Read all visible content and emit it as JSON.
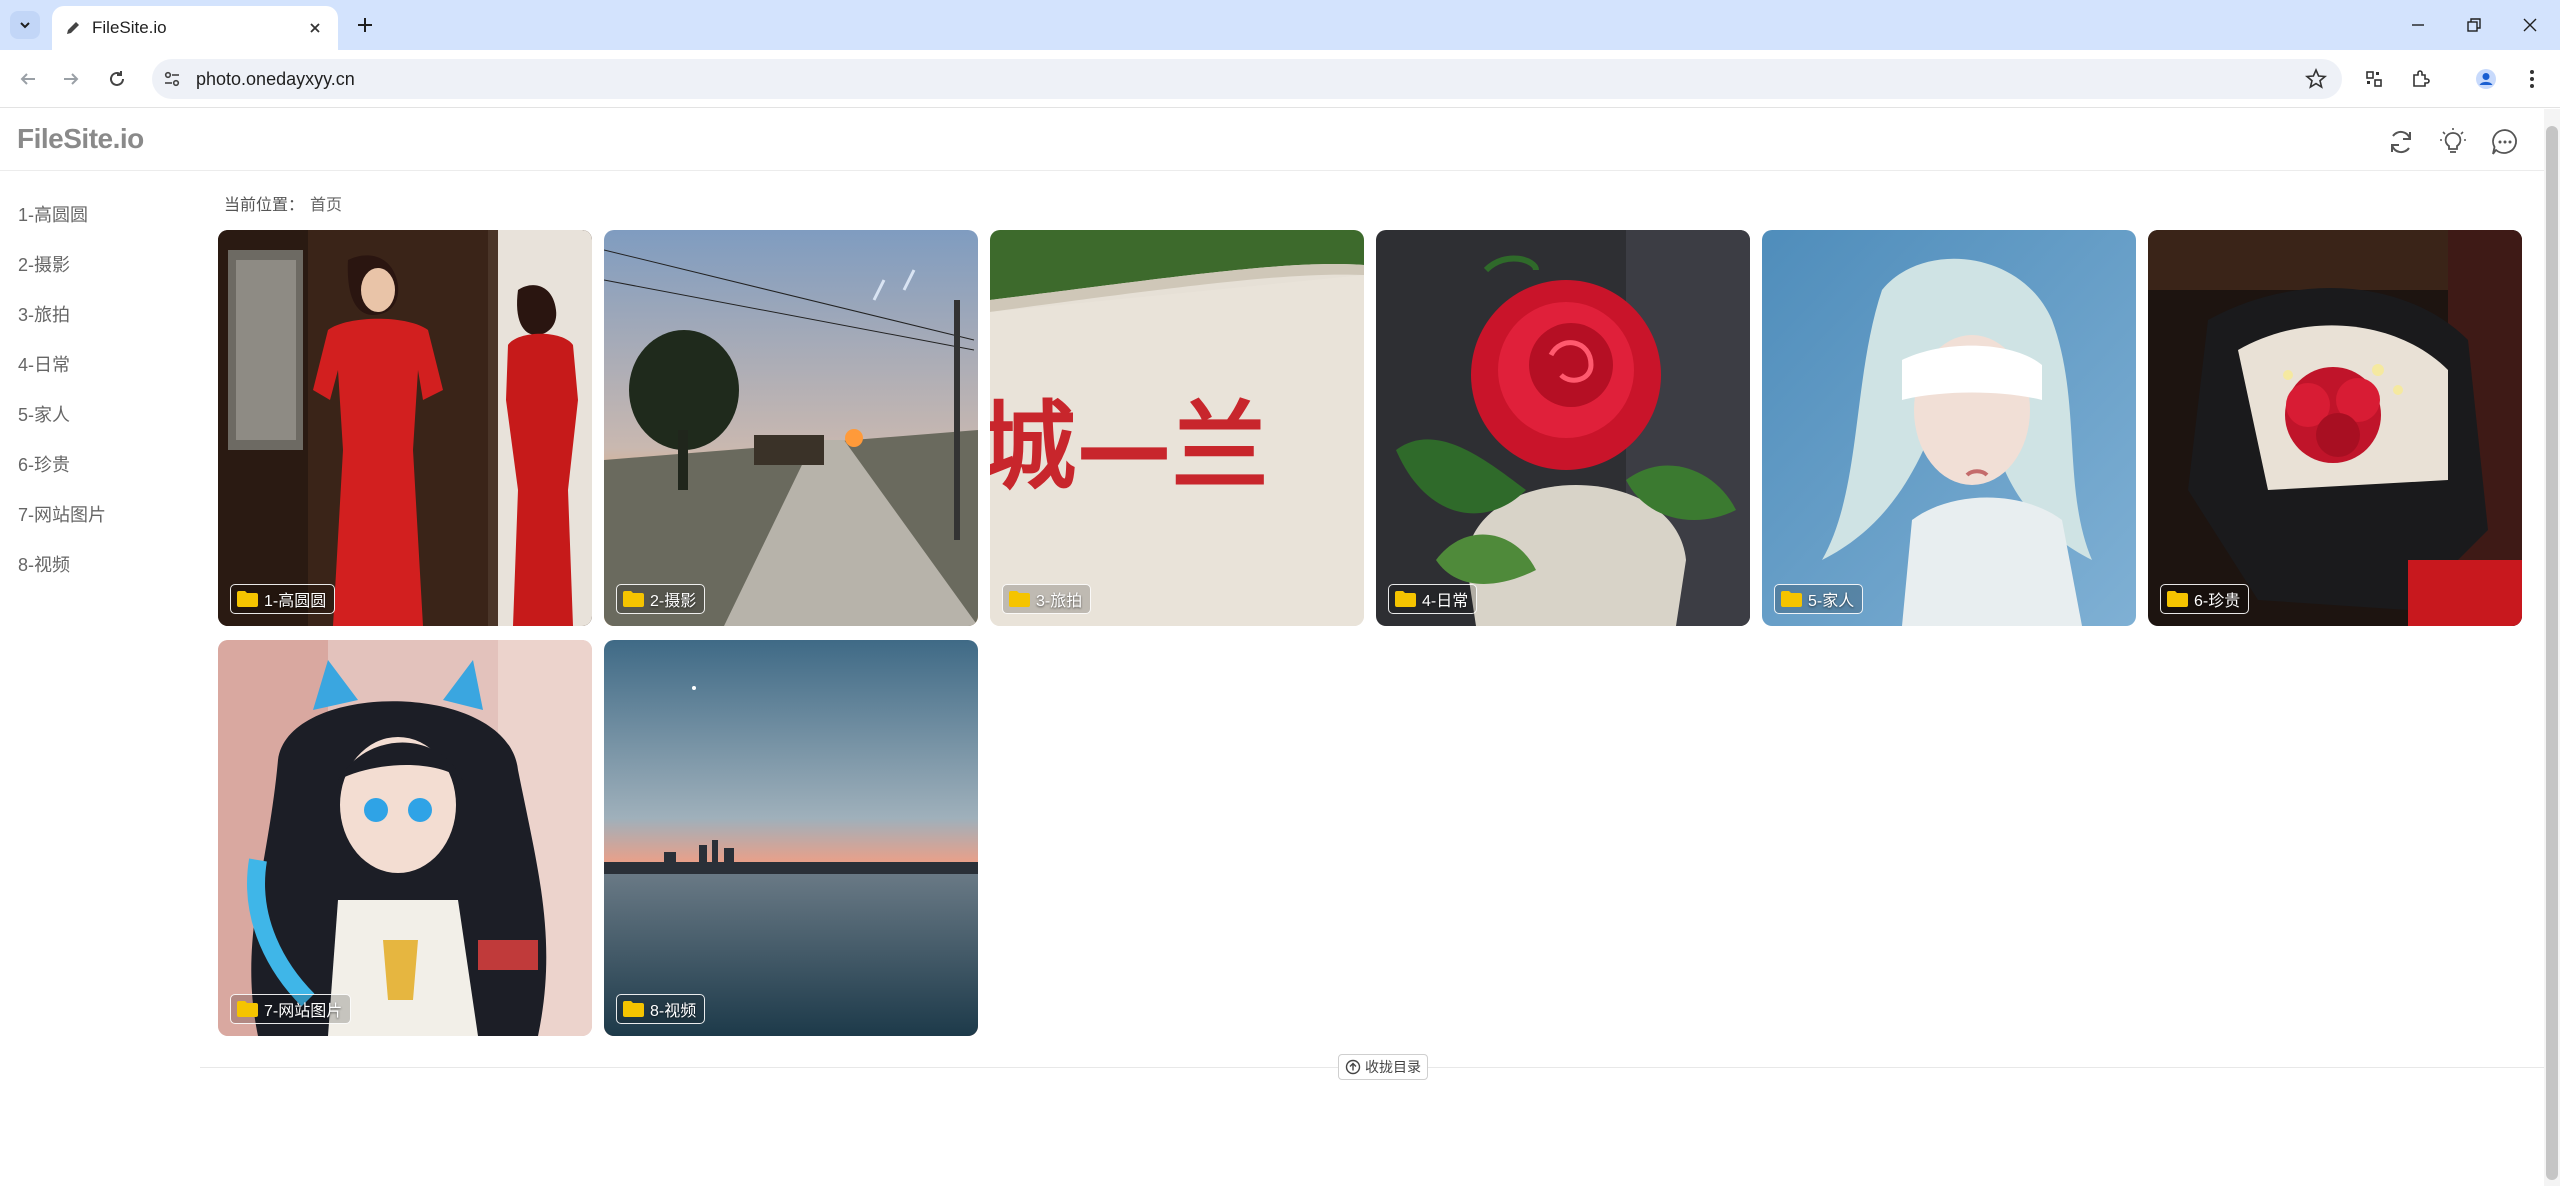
{
  "browser": {
    "tab_title": "FileSite.io",
    "url": "photo.onedayxyy.cn"
  },
  "site": {
    "logo": "FileSite.io",
    "breadcrumb_label": "当前位置：",
    "breadcrumb_home": "首页",
    "collapse_label": "收拢目录"
  },
  "sidebar": {
    "items": [
      {
        "label": "1-高圆圆"
      },
      {
        "label": "2-摄影"
      },
      {
        "label": "3-旅拍"
      },
      {
        "label": "4-日常"
      },
      {
        "label": "5-家人"
      },
      {
        "label": "6-珍贵"
      },
      {
        "label": "7-网站图片"
      },
      {
        "label": "8-视频"
      }
    ]
  },
  "folders": [
    {
      "label": "1-高圆圆"
    },
    {
      "label": "2-摄影"
    },
    {
      "label": "3-旅拍",
      "photo_text": "城—兰"
    },
    {
      "label": "4-日常"
    },
    {
      "label": "5-家人"
    },
    {
      "label": "6-珍贵"
    },
    {
      "label": "7-网站图片"
    },
    {
      "label": "8-视频"
    }
  ],
  "icons": {
    "header": [
      "refresh-icon",
      "lightbulb-icon",
      "chat-icon"
    ],
    "folder_color": "#f5c400"
  }
}
